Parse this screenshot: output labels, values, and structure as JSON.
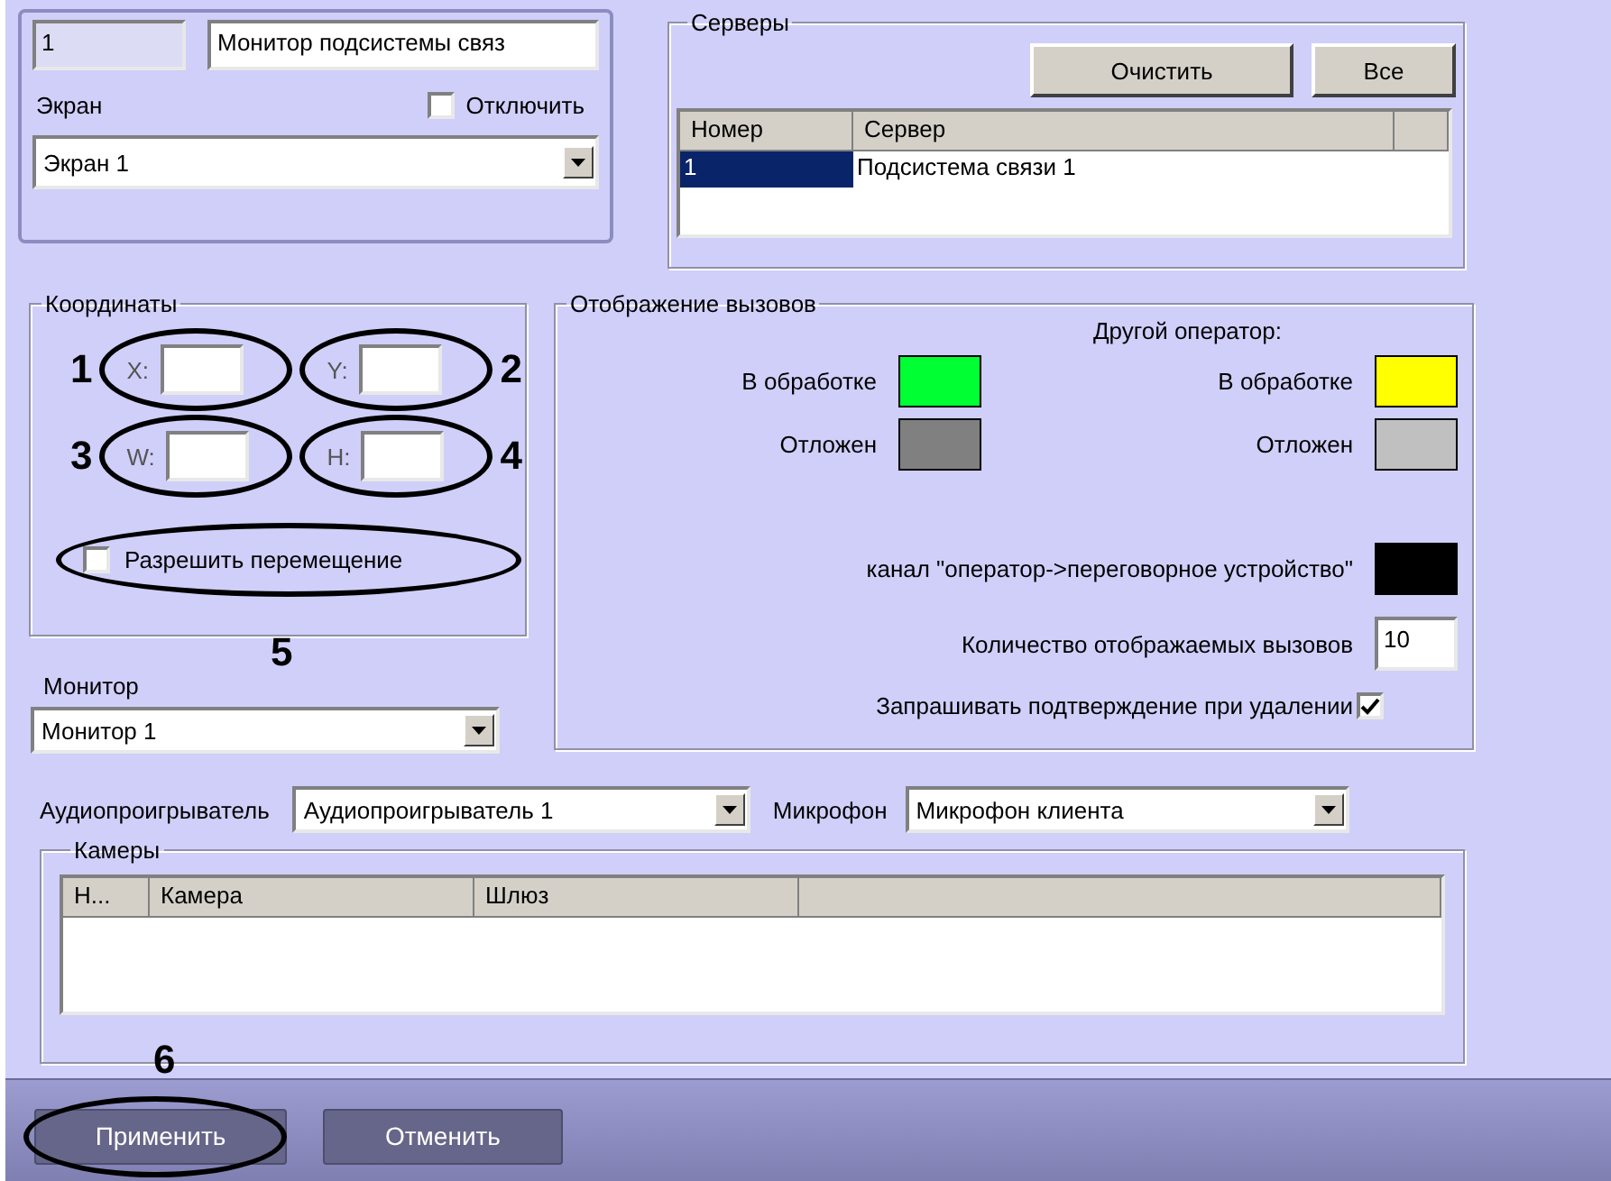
{
  "header": {
    "id_value": "1",
    "name_value": "Монитор подсистемы связ",
    "screen_label": "Экран",
    "disable": {
      "label": "Отключить",
      "checked": false
    },
    "screen_select": "Экран 1"
  },
  "servers": {
    "title": "Серверы",
    "buttons": [
      "Очистить",
      "Все"
    ],
    "columns": [
      "Номер",
      "Сервер"
    ],
    "rows": [
      {
        "cells": [
          "1",
          "Подсистема связи 1"
        ],
        "selected": true
      }
    ]
  },
  "coordinates": {
    "title": "Координаты",
    "rows": [
      [
        {
          "label": "X:",
          "callout": "1",
          "circled": true
        },
        {
          "label": "Y:",
          "callout": "2",
          "circled": true
        }
      ],
      [
        {
          "label": "W:",
          "callout": "3",
          "circled": true
        },
        {
          "label": "H:",
          "callout": "4",
          "circled": true
        }
      ]
    ],
    "allow_move": {
      "label": "Разрешить перемещение",
      "checked": false,
      "circled": true,
      "callout": "5"
    }
  },
  "monitor": {
    "label": "Монитор",
    "value": "Монитор 1"
  },
  "calls_display": {
    "title": "Отображение вызовов",
    "other_operator_label": "Другой оператор:",
    "states": [
      {
        "own": {
          "label": "В обработке",
          "color": "#00ff33"
        },
        "other": {
          "label": "В обработке",
          "color": "#ffff00"
        }
      },
      {
        "own": {
          "label": "Отложен",
          "color": "#808080"
        },
        "other": {
          "label": "Отложен",
          "color": "#c0c0c0"
        }
      }
    ],
    "channel": {
      "label": "канал \"оператор->переговорное устройство\"",
      "color": "#000000"
    },
    "count": {
      "label": "Количество отображаемых вызовов",
      "value": "10"
    },
    "confirm": {
      "label": "Запрашивать подтверждение при удалении",
      "checked": true
    }
  },
  "audio": {
    "label": "Аудиопроигрыватель",
    "value": "Аудиопроигрыватель 1"
  },
  "microphone": {
    "label": "Микрофон",
    "value": "Микрофон клиента"
  },
  "cameras": {
    "title": "Камеры",
    "columns": [
      "Н...",
      "Камера",
      "Шлюз"
    ]
  },
  "footer": {
    "callout": "6",
    "buttons": [
      {
        "label": "Применить",
        "circled": true
      },
      {
        "label": "Отменить",
        "circled": false
      }
    ]
  }
}
